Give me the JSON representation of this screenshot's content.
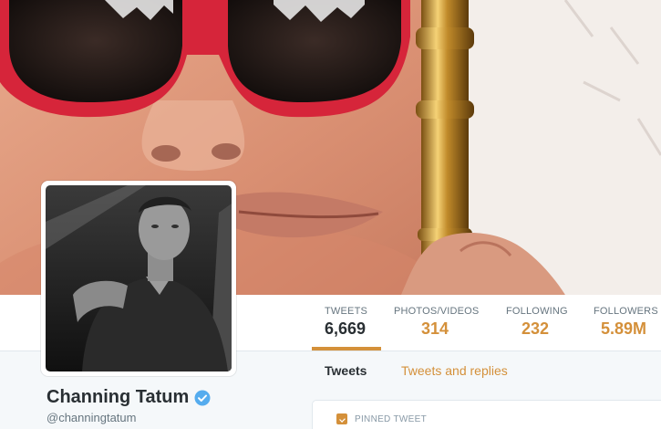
{
  "profile": {
    "name": "Channing Tatum",
    "handle": "@channingtatum"
  },
  "stats": [
    {
      "label": "TWEETS",
      "value": "6,669"
    },
    {
      "label": "PHOTOS/VIDEOS",
      "value": "314"
    },
    {
      "label": "FOLLOWING",
      "value": "232"
    },
    {
      "label": "FOLLOWERS",
      "value": "5.89M"
    }
  ],
  "tabs": [
    {
      "label": "Tweets"
    },
    {
      "label": "Tweets and replies"
    }
  ],
  "timeline": {
    "pinned_label": "PINNED TWEET"
  },
  "colors": {
    "accent": "#d4903a",
    "verified": "#55acee",
    "page_bg": "#f5f8fa"
  },
  "icons": {
    "verified": "verified-badge-icon",
    "pinned": "pin-icon"
  }
}
